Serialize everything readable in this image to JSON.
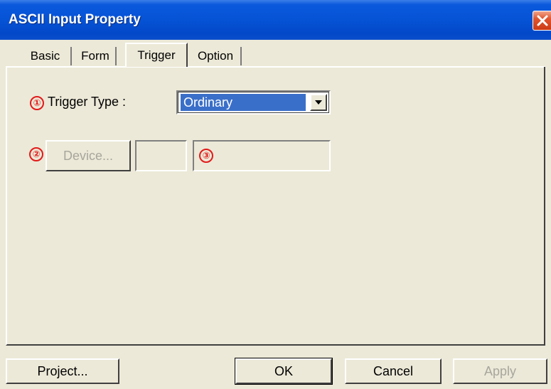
{
  "window": {
    "title": "ASCII Input Property"
  },
  "tabs": [
    {
      "label": "Basic",
      "active": false
    },
    {
      "label": "Form",
      "active": false
    },
    {
      "label": "Trigger",
      "active": true
    },
    {
      "label": "Option",
      "active": false
    }
  ],
  "trigger": {
    "marker1": "①",
    "type_label": "Trigger Type :",
    "type_value": "Ordinary",
    "marker2": "②",
    "device_button": "Device...",
    "device_enabled": false,
    "marker3": "③"
  },
  "buttons": {
    "project": "Project...",
    "ok": "OK",
    "cancel": "Cancel",
    "apply": "Apply"
  },
  "colors": {
    "title_bar": "#0653d6",
    "marker": "#e21b1b",
    "selection": "#3a6fc9",
    "face": "#ece9d8"
  },
  "icons": {
    "close": "close-icon",
    "dropdown": "chevron-down-icon"
  }
}
